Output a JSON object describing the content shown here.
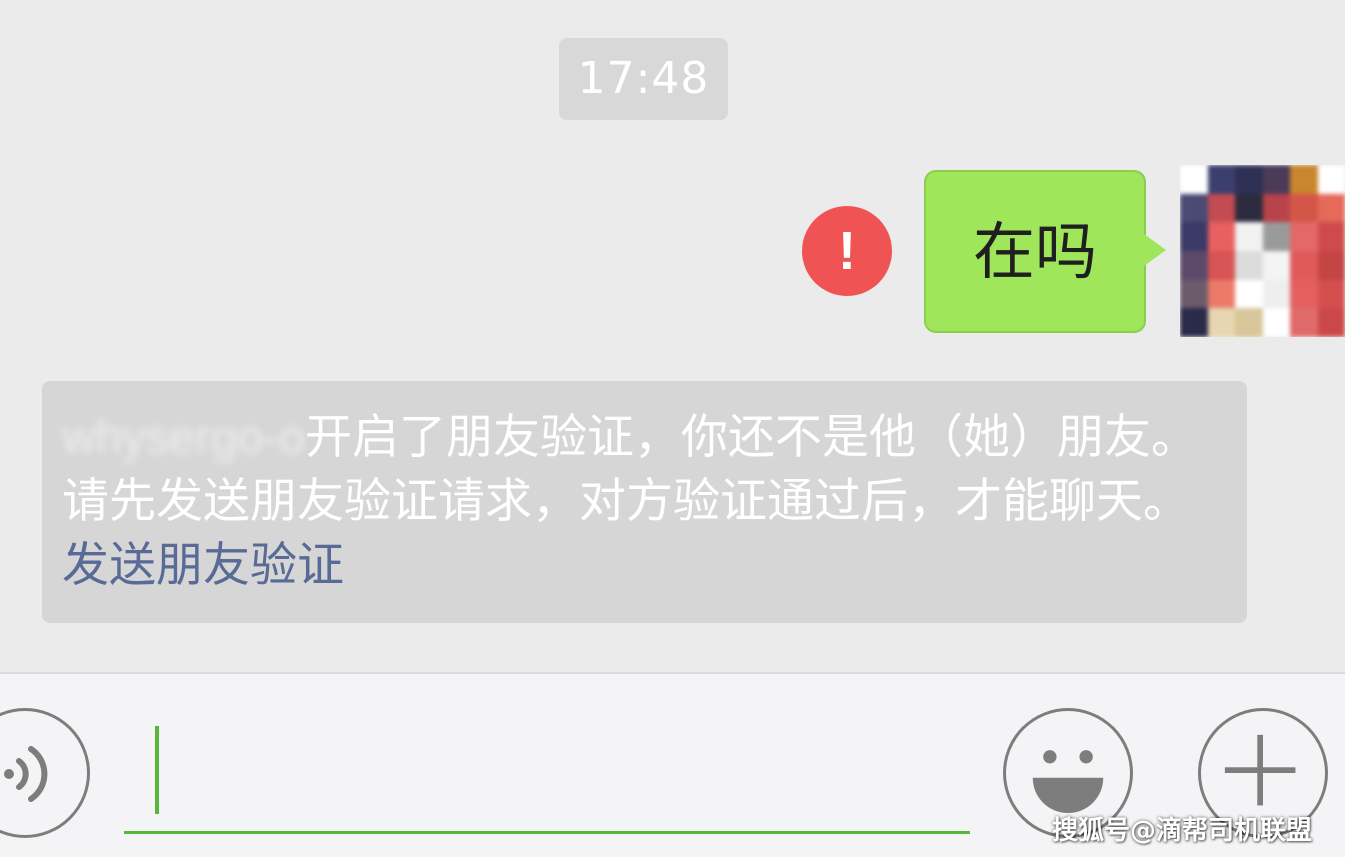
{
  "chat": {
    "timestamp": "17:48",
    "outgoing_message": {
      "text": "在吗",
      "status_icon": "error-exclamation-icon",
      "status_symbol": "!",
      "bubble_color": "#9fe65b"
    },
    "system_notice": {
      "blurred_name": "whysergo-o",
      "text": "开启了朋友验证，你还不是他（她）朋友。请先发送朋友验证请求，对方验证通过后，才能聊天。",
      "link_text": "发送朋友验证",
      "link_color": "#586a96"
    }
  },
  "input_bar": {
    "voice_icon": "voice-wave-icon",
    "emoji_icon": "smiley-face-icon",
    "plus_icon": "plus-icon",
    "accent_color": "#56b83a"
  },
  "watermark": "搜狐号@滴帮司机联盟"
}
